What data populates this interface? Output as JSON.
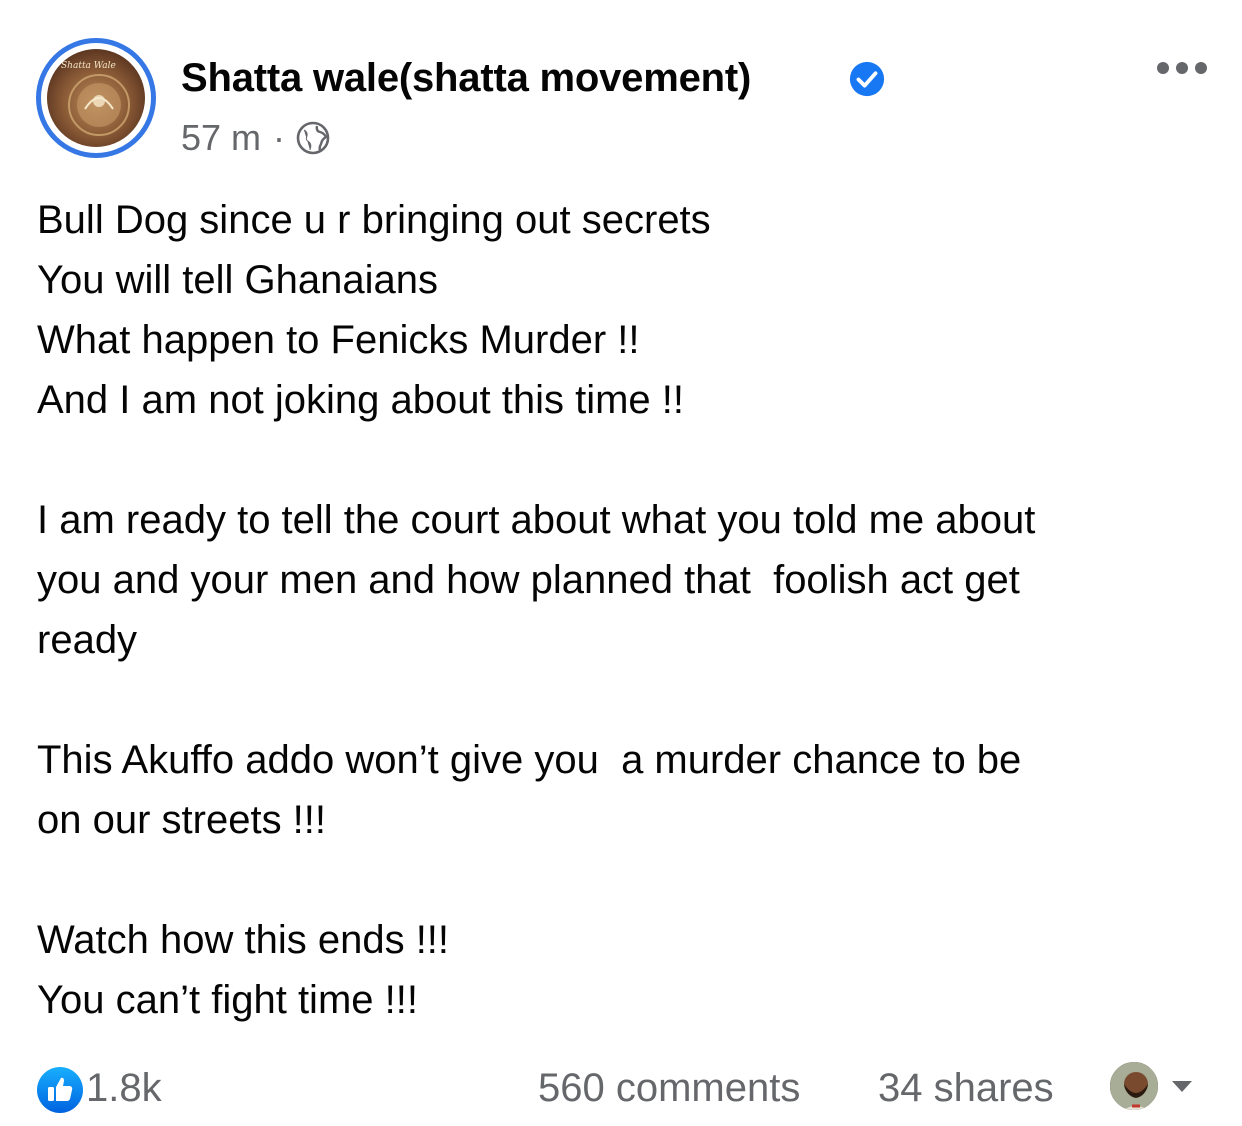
{
  "post": {
    "author": "Shatta wale(shatta movement)",
    "timestamp": "57 m",
    "separator": "·",
    "avatar_label": "Shatta Wale",
    "body_lines": [
      "Bull Dog since u r bringing out secrets",
      "You will tell Ghanaians",
      "What happen to Fenicks Murder !!",
      "And I am not joking about this time !!",
      "",
      "I am ready to tell the court about what you told me about",
      "you and your men and how planned that  foolish act get",
      "ready",
      "",
      "This Akuffo addo won’t give you  a murder chance to be",
      "on our streets !!!",
      "",
      "Watch how this ends !!!",
      "You can’t fight time !!!"
    ],
    "icons": {
      "verified": "verified-badge-icon",
      "audience": "globe-icon",
      "more": "more-options-icon",
      "like": "like-icon",
      "dropdown": "chevron-down-icon"
    }
  },
  "footer": {
    "likes": "1.8k",
    "comments": "560 comments",
    "shares": "34 shares"
  },
  "colors": {
    "accent": "#1877f2",
    "ring": "#3578e5",
    "secondary_text": "#65676b",
    "text": "#050505"
  }
}
